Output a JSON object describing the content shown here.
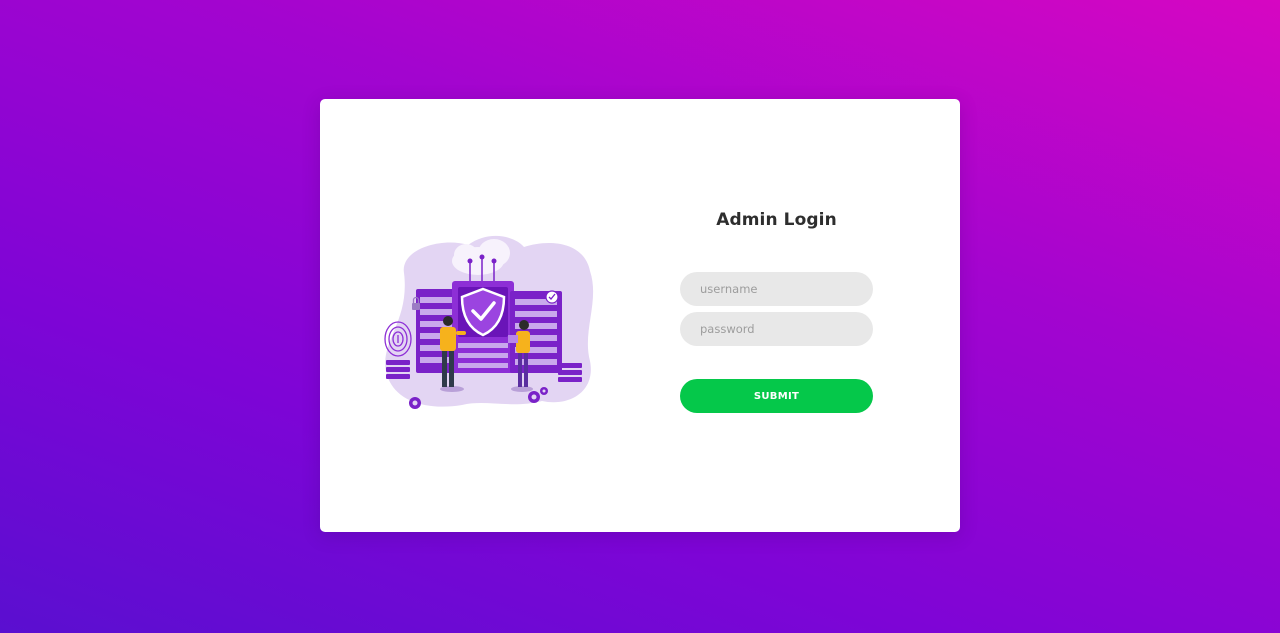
{
  "login": {
    "title": "Admin Login",
    "username_placeholder": "username",
    "password_placeholder": "password",
    "submit_label": "SUBMIT"
  },
  "illustration": {
    "icon": "security-server-illustration"
  },
  "colors": {
    "background_start": "#5a0fd0",
    "background_end": "#d606c2",
    "card": "#ffffff",
    "input_bg": "#e8e8e8",
    "submit": "#05c84a",
    "illustration_purple": "#7a22c8",
    "illustration_light": "#d9c7ef",
    "figure_yellow": "#f6b21c"
  }
}
